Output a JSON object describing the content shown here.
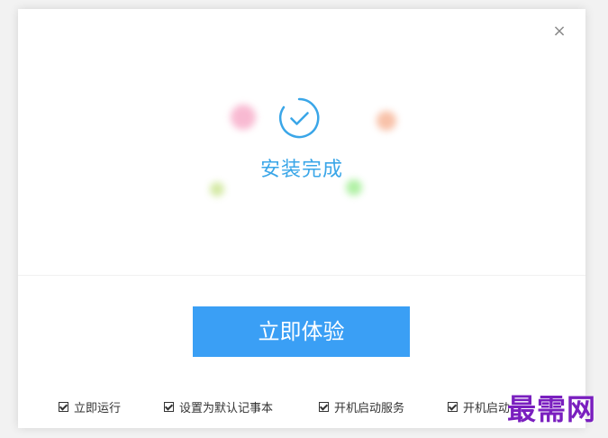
{
  "dialog": {
    "close_label": "×",
    "status_title": "安装完成",
    "icons": {
      "success": "check-circle-icon",
      "close": "close-icon",
      "checkbox": "checkbox-checked-icon"
    },
    "primary_button_label": "立即体验",
    "options": [
      {
        "label": "立即运行",
        "checked": true
      },
      {
        "label": "设置为默认记事本",
        "checked": true
      },
      {
        "label": "开机启动服务",
        "checked": true
      },
      {
        "label": "开机启动",
        "checked": true
      }
    ]
  },
  "colors": {
    "accent": "#3a9ff5",
    "title_blue": "#3aa6e8",
    "watermark_purple": "#7a1fbf"
  },
  "watermark": {
    "text": "最需网"
  }
}
